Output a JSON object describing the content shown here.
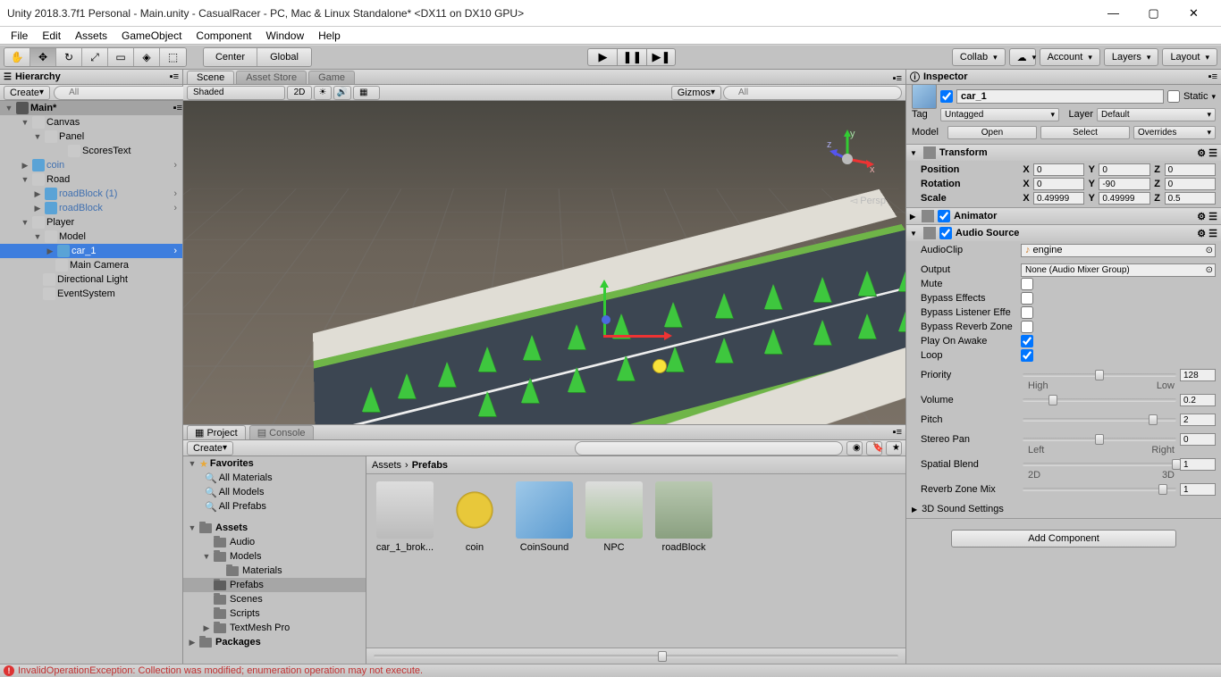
{
  "window": {
    "title": "Unity 2018.3.7f1 Personal - Main.unity - CasualRacer - PC, Mac & Linux Standalone* <DX11 on DX10 GPU>"
  },
  "menu": [
    "File",
    "Edit",
    "Assets",
    "GameObject",
    "Component",
    "Window",
    "Help"
  ],
  "toolbar": {
    "center": "Center",
    "global": "Global",
    "collab": "Collab",
    "account": "Account",
    "layers": "Layers",
    "layout": "Layout"
  },
  "hierarchy": {
    "title": "Hierarchy",
    "create": "Create",
    "search_ph": "All",
    "scene": "Main*",
    "items": [
      {
        "name": "Canvas",
        "indent": 1,
        "text_indent": 0,
        "type": "go",
        "toggle": "▼"
      },
      {
        "name": "Panel",
        "indent": 2,
        "text_indent": 0,
        "type": "go",
        "toggle": "▼"
      },
      {
        "name": "ScoresText",
        "indent": 3,
        "text_indent": 12,
        "type": "go",
        "toggle": ""
      },
      {
        "name": "coin",
        "indent": 1,
        "text_indent": 0,
        "type": "prefab",
        "toggle": "▶"
      },
      {
        "name": "Road",
        "indent": 1,
        "text_indent": 0,
        "type": "go",
        "toggle": "▼"
      },
      {
        "name": "roadBlock (1)",
        "indent": 2,
        "text_indent": 0,
        "type": "prefab",
        "toggle": "▶"
      },
      {
        "name": "roadBlock",
        "indent": 2,
        "text_indent": 0,
        "type": "prefab",
        "toggle": "▶"
      },
      {
        "name": "Player",
        "indent": 1,
        "text_indent": 0,
        "type": "go",
        "toggle": "▼"
      },
      {
        "name": "Model",
        "indent": 2,
        "text_indent": 0,
        "type": "go",
        "toggle": "▼"
      },
      {
        "name": "car_1",
        "indent": 3,
        "text_indent": 0,
        "type": "prefab",
        "selected": true,
        "toggle": "▶"
      },
      {
        "name": "Main Camera",
        "indent": 2,
        "text_indent": 12,
        "type": "go",
        "toggle": ""
      },
      {
        "name": "Directional Light",
        "indent": 1,
        "text_indent": 12,
        "type": "go",
        "toggle": ""
      },
      {
        "name": "EventSystem",
        "indent": 1,
        "text_indent": 12,
        "type": "go",
        "toggle": ""
      }
    ]
  },
  "scene": {
    "tab_scene": "Scene",
    "tab_asset": "Asset Store",
    "tab_game": "Game",
    "shaded": "Shaded",
    "mode_2d": "2D",
    "gizmos": "Gizmos",
    "search_ph": "All",
    "persp": "Persp"
  },
  "project": {
    "tab_project": "Project",
    "tab_console": "Console",
    "create": "Create",
    "favorites": "Favorites",
    "fav_items": [
      "All Materials",
      "All Models",
      "All Prefabs"
    ],
    "assets": "Assets",
    "folders": [
      "Audio",
      "Models",
      "Materials",
      "Prefabs",
      "Scenes",
      "Scripts",
      "TextMesh Pro"
    ],
    "packages": "Packages",
    "breadcrumb": [
      "Assets",
      "Prefabs"
    ],
    "items": [
      "car_1_brok...",
      "coin",
      "CoinSound",
      "NPC",
      "roadBlock"
    ]
  },
  "inspector": {
    "title": "Inspector",
    "name": "car_1",
    "static": "Static",
    "tag_label": "Tag",
    "tag_val": "Untagged",
    "layer_label": "Layer",
    "layer_val": "Default",
    "model_label": "Model",
    "open": "Open",
    "select": "Select",
    "overrides": "Overrides",
    "transform": {
      "title": "Transform",
      "position": "Position",
      "px": "0",
      "py": "0",
      "pz": "0",
      "rotation": "Rotation",
      "rx": "0",
      "ry": "-90",
      "rz": "0",
      "scale": "Scale",
      "sx": "0.49999",
      "sy": "0.49999",
      "sz": "0.5"
    },
    "animator": {
      "title": "Animator"
    },
    "audio": {
      "title": "Audio Source",
      "clip_label": "AudioClip",
      "clip_val": "engine",
      "output_label": "Output",
      "output_val": "None (Audio Mixer Group)",
      "mute": "Mute",
      "bypass_fx": "Bypass Effects",
      "bypass_listener": "Bypass Listener Effe",
      "bypass_reverb": "Bypass Reverb Zone",
      "play_awake": "Play On Awake",
      "loop": "Loop",
      "priority": "Priority",
      "priority_val": "128",
      "priority_left": "High",
      "priority_right": "Low",
      "volume": "Volume",
      "volume_val": "0.2",
      "pitch": "Pitch",
      "pitch_val": "2",
      "stereo": "Stereo Pan",
      "stereo_val": "0",
      "stereo_left": "Left",
      "stereo_right": "Right",
      "spatial": "Spatial Blend",
      "spatial_val": "1",
      "spatial_left": "2D",
      "spatial_right": "3D",
      "reverb": "Reverb Zone Mix",
      "reverb_val": "1",
      "sound3d": "3D Sound Settings"
    },
    "add_component": "Add Component"
  },
  "status": {
    "error": "InvalidOperationException: Collection was modified; enumeration operation may not execute."
  }
}
